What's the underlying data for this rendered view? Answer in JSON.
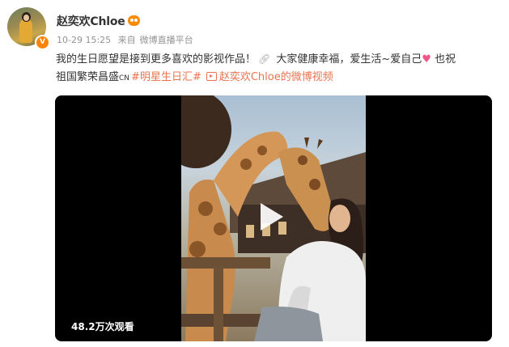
{
  "author": {
    "name": "赵奕欢Chloe",
    "avatar_icon": "user-avatar",
    "verified_icon": "verified-v-badge",
    "level_icon": "member-level-badge",
    "verified_label": "V"
  },
  "meta": {
    "date": "10-29 15:25",
    "source_prefix": "来自",
    "source_name": "微博直播平台"
  },
  "post": {
    "text_part1": "我的生日愿望是接到更多喜欢的影视作品！",
    "text_part2": "大家健康幸福，爱生活~爱自己",
    "text_part3": "也祝",
    "text_part4": "祖国繁荣昌盛",
    "cn_mark": "CN",
    "hashtag": "#明星生日汇#",
    "video_link": "赵奕欢Chloe的微博视频",
    "link_icon": "link-icon",
    "heart_icon": "heart-emoji"
  },
  "video": {
    "view_count": "48.2万次观看",
    "play_icon": "play-icon"
  },
  "colors": {
    "link": "#eb7350",
    "text": "#333333",
    "meta": "#939393",
    "verified_badge": "#ff8200"
  }
}
